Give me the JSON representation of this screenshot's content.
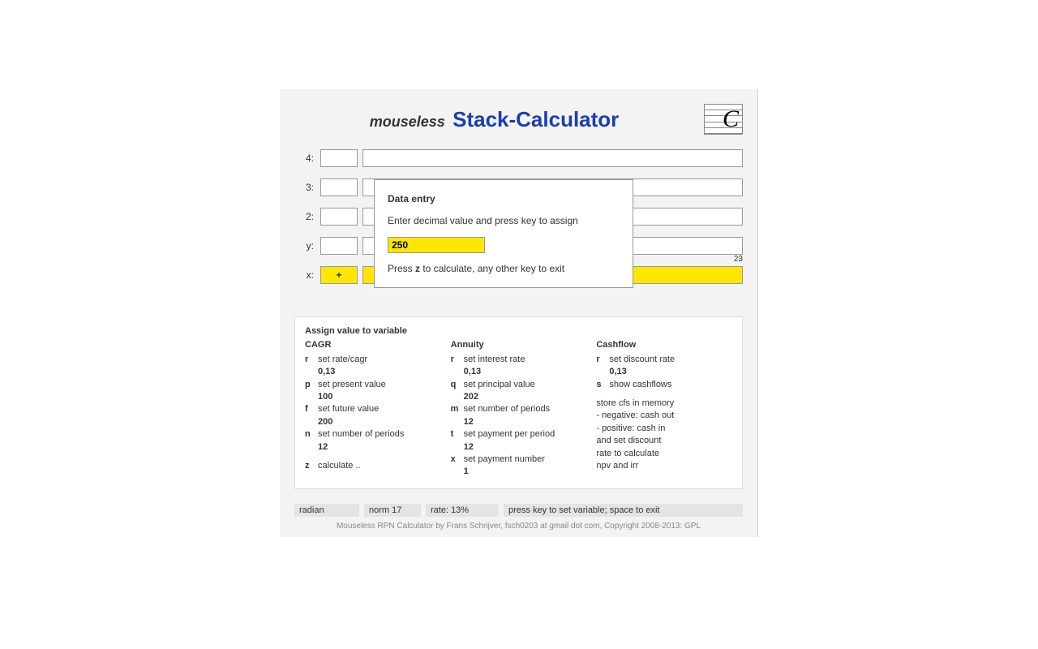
{
  "header": {
    "small": "mouseless",
    "big": "Stack-Calculator"
  },
  "stack": {
    "rows": [
      {
        "label": "4:",
        "op": "",
        "val": "",
        "hl": false
      },
      {
        "label": "3:",
        "op": "",
        "val": "",
        "hl": false
      },
      {
        "label": "2:",
        "op": "",
        "val": "",
        "hl": false
      },
      {
        "label": "y:",
        "op": "",
        "val": "",
        "hl": false
      },
      {
        "label": "x:",
        "op": "+",
        "val": "",
        "hl": true
      }
    ],
    "counter": "23"
  },
  "popup": {
    "title": "Data entry",
    "text": "Enter decimal value and press key to assign",
    "value": "250",
    "hint_pre": "Press ",
    "hint_key": "z",
    "hint_post": " to calculate, any other key to exit"
  },
  "help": {
    "title": "Assign value to variable",
    "cagr": {
      "title": "CAGR",
      "items": [
        {
          "k": "r",
          "desc": "set rate/cagr",
          "val": "0,13"
        },
        {
          "k": "p",
          "desc": "set present value",
          "val": "100"
        },
        {
          "k": "f",
          "desc": "set future value",
          "val": "200"
        },
        {
          "k": "n",
          "desc": "set number of periods",
          "val": "12"
        },
        {
          "k": "z",
          "desc": "calculate ..",
          "val": ""
        }
      ]
    },
    "annuity": {
      "title": "Annuity",
      "items": [
        {
          "k": "r",
          "desc": "set interest rate",
          "val": "0,13"
        },
        {
          "k": "q",
          "desc": "set principal value",
          "val": "202"
        },
        {
          "k": "m",
          "desc": "set number of periods",
          "val": "12"
        },
        {
          "k": "t",
          "desc": "set payment per period",
          "val": "12"
        },
        {
          "k": "x",
          "desc": "set payment number",
          "val": "1"
        }
      ]
    },
    "cashflow": {
      "title": "Cashflow",
      "items": [
        {
          "k": "r",
          "desc": "set discount rate",
          "val": "0,13"
        },
        {
          "k": "s",
          "desc": "show cashflows",
          "val": ""
        }
      ],
      "notes": [
        "store cfs in memory",
        "- negative: cash out",
        "- positive: cash in",
        "and set discount",
        "rate to calculate",
        "npv and irr"
      ]
    }
  },
  "status": {
    "mode": "radian",
    "norm": "norm 17",
    "rate": "rate: 13%",
    "msg": "press key to set variable; space to exit"
  },
  "footer": "Mouseless RPN Calculator by Frans Schrijver, fsch0203 at gmail dot com, Copyright 2008-2013: GPL"
}
